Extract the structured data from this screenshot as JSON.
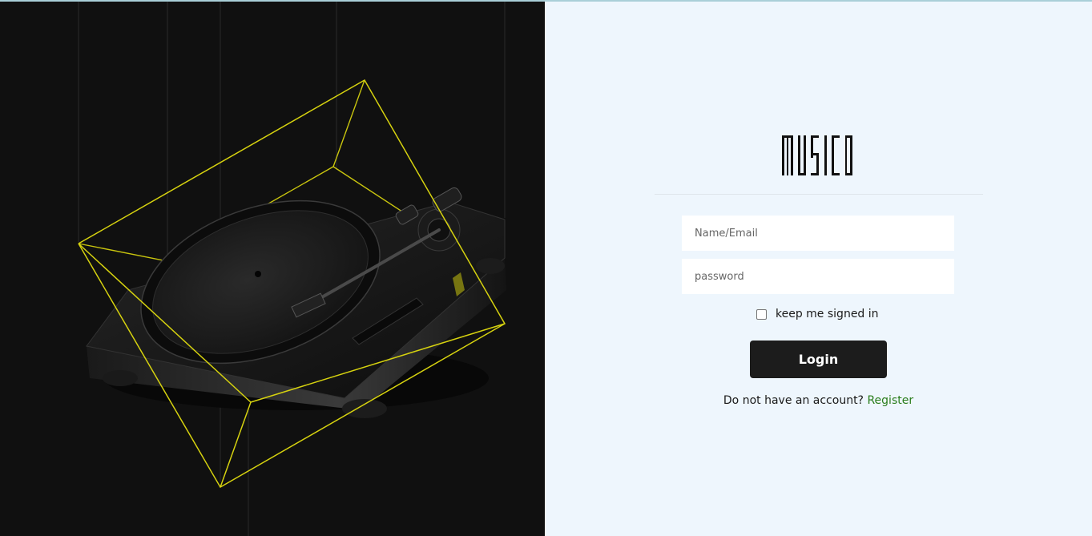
{
  "brand": {
    "logo_text": "MUSIC"
  },
  "login_form": {
    "name_placeholder": "Name/Email",
    "password_placeholder": "password",
    "remember_label": "keep me signed in",
    "remember_checked": false,
    "submit_label": "Login"
  },
  "register": {
    "prompt": "Do not have an account?",
    "link_label": "Register"
  },
  "colors": {
    "hero_background": "#101010",
    "panel_background": "#eef6fd",
    "wireframe_accent": "#d6d20f",
    "button_background": "#1c1c1c",
    "link_color": "#2a7d1c"
  },
  "icons": {
    "hero_image": "turntable-wireframe-illustration"
  }
}
